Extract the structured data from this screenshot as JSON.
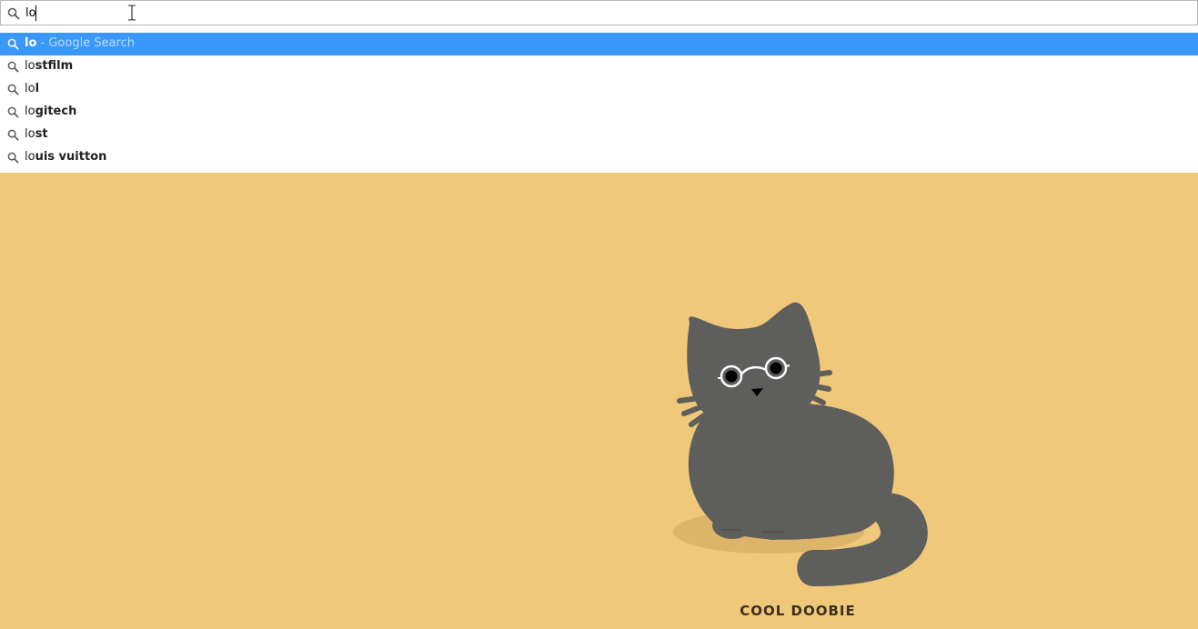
{
  "omnibox": {
    "value": "lo",
    "search_icon": "search-icon"
  },
  "suggestions": [
    {
      "typed": "lo",
      "rest": " - Google Search",
      "selected": true
    },
    {
      "typed": "lo",
      "rest": "stfilm",
      "selected": false
    },
    {
      "typed": "lo",
      "rest": "l",
      "selected": false
    },
    {
      "typed": "lo",
      "rest": "gitech",
      "selected": false
    },
    {
      "typed": "lo",
      "rest": "st",
      "selected": false
    },
    {
      "typed": "lo",
      "rest": "uis vuitton",
      "selected": false
    }
  ],
  "wallpaper": {
    "caption": "COOL DOOBIE",
    "background_color": "#f0c87a",
    "cat_color": "#5e5e5c",
    "highlight_color": "#3a97fb"
  }
}
